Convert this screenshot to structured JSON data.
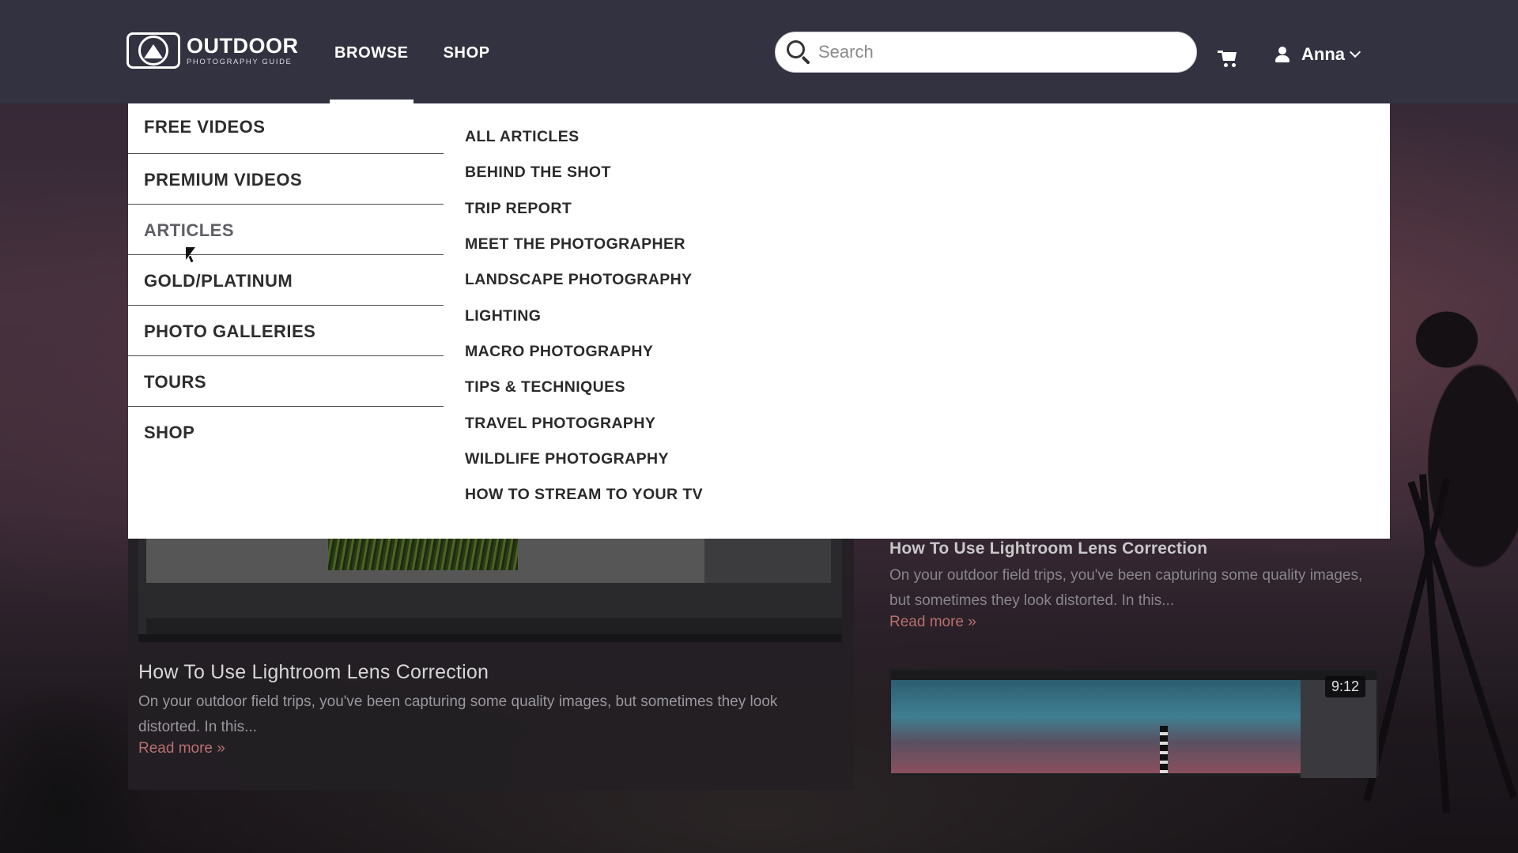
{
  "header": {
    "logo": {
      "line1": "OUTDOOR",
      "line2": "PHOTOGRAPHY GUIDE"
    },
    "nav": [
      {
        "label": "BROWSE",
        "active": true
      },
      {
        "label": "SHOP",
        "active": false
      }
    ],
    "search": {
      "placeholder": "Search",
      "value": ""
    },
    "user": {
      "name": "Anna"
    }
  },
  "dropdown": {
    "primary": [
      {
        "label": "FREE VIDEOS"
      },
      {
        "label": "PREMIUM VIDEOS"
      },
      {
        "label": "ARTICLES",
        "active": true
      },
      {
        "label": "GOLD/PLATINUM"
      },
      {
        "label": "PHOTO GALLERIES"
      },
      {
        "label": "TOURS"
      },
      {
        "label": "SHOP"
      }
    ],
    "secondary": [
      {
        "label": "ALL ARTICLES"
      },
      {
        "label": "BEHIND THE SHOT"
      },
      {
        "label": "TRIP REPORT"
      },
      {
        "label": "MEET THE PHOTOGRAPHER"
      },
      {
        "label": "LANDSCAPE PHOTOGRAPHY"
      },
      {
        "label": "LIGHTING"
      },
      {
        "label": "MACRO PHOTOGRAPHY"
      },
      {
        "label": "TIPS & TECHNIQUES"
      },
      {
        "label": "TRAVEL PHOTOGRAPHY"
      },
      {
        "label": "WILDLIFE PHOTOGRAPHY"
      },
      {
        "label": "HOW TO STREAM TO YOUR TV"
      }
    ]
  },
  "cards": {
    "left": {
      "title": "How To Use Lightroom Lens Correction",
      "excerpt": "On your outdoor field trips, you've been capturing some quality images, but sometimes they look distorted. In this...",
      "more": "Read more »"
    },
    "right": {
      "title": "How To Use Lightroom Lens Correction",
      "excerpt": "On your outdoor field trips, you've been capturing some quality images, but sometimes they look distorted. In this...",
      "more": "Read more »",
      "duration": "9:12"
    }
  },
  "colors": {
    "header_bg": "#323241",
    "dropdown_bg": "#ffffff",
    "read_more": "#b77070"
  }
}
